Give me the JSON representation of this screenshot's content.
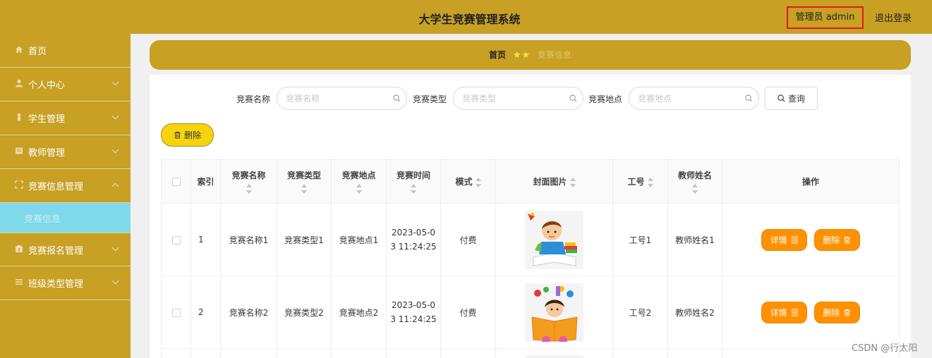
{
  "header": {
    "title": "大学生竞赛管理系统",
    "user": "管理员 admin",
    "logout": "退出登录"
  },
  "sidebar": {
    "items": [
      {
        "label": "首页",
        "icon": "home-icon",
        "glyph": "⌂"
      },
      {
        "label": "个人中心",
        "icon": "user-icon",
        "glyph": "👤"
      },
      {
        "label": "学生管理",
        "icon": "student-icon",
        "glyph": "♟"
      },
      {
        "label": "教师管理",
        "icon": "teacher-icon",
        "glyph": "▦"
      },
      {
        "label": "竞赛信息管理",
        "icon": "info-icon",
        "glyph": "⬚"
      },
      {
        "label": "竞赛信息",
        "icon": "",
        "glyph": ""
      },
      {
        "label": "竞赛报名管理",
        "icon": "register-icon",
        "glyph": "▤"
      },
      {
        "label": "班级类型管理",
        "icon": "class-icon",
        "glyph": "☰"
      }
    ]
  },
  "breadcrumb": {
    "home": "首页",
    "stars": "★★",
    "current": "竞赛信息"
  },
  "search": {
    "name_label": "竞赛名称",
    "name_placeholder": "竞赛名称",
    "type_label": "竞赛类型",
    "type_placeholder": "竞赛类型",
    "place_label": "竞赛地点",
    "place_placeholder": "竞赛地点",
    "query_button": "查询"
  },
  "toolbar": {
    "delete_label": "删除"
  },
  "table": {
    "columns": [
      "索引",
      "竞赛名称",
      "竞赛类型",
      "竞赛地点",
      "竞赛时间",
      "模式",
      "封面图片",
      "工号",
      "教师姓名",
      "操作"
    ],
    "rows": [
      {
        "index": "1",
        "name": "竞赛名称1",
        "type": "竞赛类型1",
        "place": "竞赛地点1",
        "time": "2023-05-03 11:24:25",
        "mode": "付费",
        "job_no": "工号1",
        "teacher": "教师姓名1"
      },
      {
        "index": "2",
        "name": "竞赛名称2",
        "type": "竞赛类型2",
        "place": "竞赛地点2",
        "time": "2023-05-03 11:24:25",
        "mode": "付费",
        "job_no": "工号2",
        "teacher": "教师姓名2"
      }
    ],
    "detail_label": "详情",
    "delete_label": "删除"
  },
  "watermark": "CSDN @行太阳"
}
